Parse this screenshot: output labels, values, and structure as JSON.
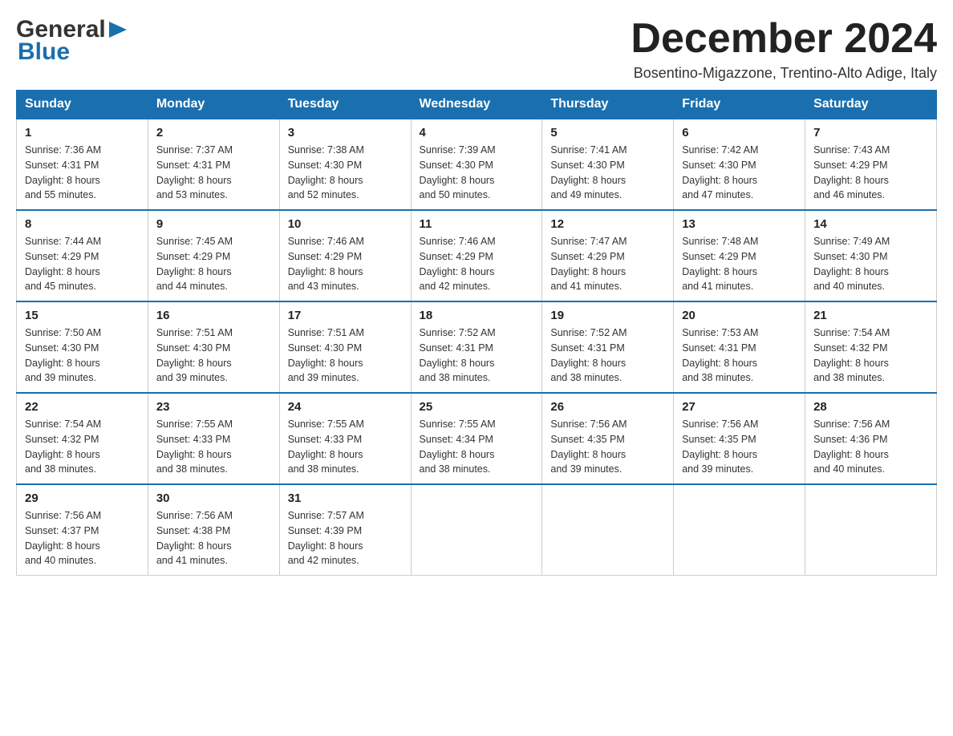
{
  "logo": {
    "general": "General",
    "blue": "Blue",
    "arrow": "▶"
  },
  "header": {
    "month": "December 2024",
    "location": "Bosentino-Migazzone, Trentino-Alto Adige, Italy"
  },
  "days_of_week": [
    "Sunday",
    "Monday",
    "Tuesday",
    "Wednesday",
    "Thursday",
    "Friday",
    "Saturday"
  ],
  "weeks": [
    [
      {
        "day": "1",
        "sunrise": "7:36 AM",
        "sunset": "4:31 PM",
        "daylight": "8 hours and 55 minutes."
      },
      {
        "day": "2",
        "sunrise": "7:37 AM",
        "sunset": "4:31 PM",
        "daylight": "8 hours and 53 minutes."
      },
      {
        "day": "3",
        "sunrise": "7:38 AM",
        "sunset": "4:30 PM",
        "daylight": "8 hours and 52 minutes."
      },
      {
        "day": "4",
        "sunrise": "7:39 AM",
        "sunset": "4:30 PM",
        "daylight": "8 hours and 50 minutes."
      },
      {
        "day": "5",
        "sunrise": "7:41 AM",
        "sunset": "4:30 PM",
        "daylight": "8 hours and 49 minutes."
      },
      {
        "day": "6",
        "sunrise": "7:42 AM",
        "sunset": "4:30 PM",
        "daylight": "8 hours and 47 minutes."
      },
      {
        "day": "7",
        "sunrise": "7:43 AM",
        "sunset": "4:29 PM",
        "daylight": "8 hours and 46 minutes."
      }
    ],
    [
      {
        "day": "8",
        "sunrise": "7:44 AM",
        "sunset": "4:29 PM",
        "daylight": "8 hours and 45 minutes."
      },
      {
        "day": "9",
        "sunrise": "7:45 AM",
        "sunset": "4:29 PM",
        "daylight": "8 hours and 44 minutes."
      },
      {
        "day": "10",
        "sunrise": "7:46 AM",
        "sunset": "4:29 PM",
        "daylight": "8 hours and 43 minutes."
      },
      {
        "day": "11",
        "sunrise": "7:46 AM",
        "sunset": "4:29 PM",
        "daylight": "8 hours and 42 minutes."
      },
      {
        "day": "12",
        "sunrise": "7:47 AM",
        "sunset": "4:29 PM",
        "daylight": "8 hours and 41 minutes."
      },
      {
        "day": "13",
        "sunrise": "7:48 AM",
        "sunset": "4:29 PM",
        "daylight": "8 hours and 41 minutes."
      },
      {
        "day": "14",
        "sunrise": "7:49 AM",
        "sunset": "4:30 PM",
        "daylight": "8 hours and 40 minutes."
      }
    ],
    [
      {
        "day": "15",
        "sunrise": "7:50 AM",
        "sunset": "4:30 PM",
        "daylight": "8 hours and 39 minutes."
      },
      {
        "day": "16",
        "sunrise": "7:51 AM",
        "sunset": "4:30 PM",
        "daylight": "8 hours and 39 minutes."
      },
      {
        "day": "17",
        "sunrise": "7:51 AM",
        "sunset": "4:30 PM",
        "daylight": "8 hours and 39 minutes."
      },
      {
        "day": "18",
        "sunrise": "7:52 AM",
        "sunset": "4:31 PM",
        "daylight": "8 hours and 38 minutes."
      },
      {
        "day": "19",
        "sunrise": "7:52 AM",
        "sunset": "4:31 PM",
        "daylight": "8 hours and 38 minutes."
      },
      {
        "day": "20",
        "sunrise": "7:53 AM",
        "sunset": "4:31 PM",
        "daylight": "8 hours and 38 minutes."
      },
      {
        "day": "21",
        "sunrise": "7:54 AM",
        "sunset": "4:32 PM",
        "daylight": "8 hours and 38 minutes."
      }
    ],
    [
      {
        "day": "22",
        "sunrise": "7:54 AM",
        "sunset": "4:32 PM",
        "daylight": "8 hours and 38 minutes."
      },
      {
        "day": "23",
        "sunrise": "7:55 AM",
        "sunset": "4:33 PM",
        "daylight": "8 hours and 38 minutes."
      },
      {
        "day": "24",
        "sunrise": "7:55 AM",
        "sunset": "4:33 PM",
        "daylight": "8 hours and 38 minutes."
      },
      {
        "day": "25",
        "sunrise": "7:55 AM",
        "sunset": "4:34 PM",
        "daylight": "8 hours and 38 minutes."
      },
      {
        "day": "26",
        "sunrise": "7:56 AM",
        "sunset": "4:35 PM",
        "daylight": "8 hours and 39 minutes."
      },
      {
        "day": "27",
        "sunrise": "7:56 AM",
        "sunset": "4:35 PM",
        "daylight": "8 hours and 39 minutes."
      },
      {
        "day": "28",
        "sunrise": "7:56 AM",
        "sunset": "4:36 PM",
        "daylight": "8 hours and 40 minutes."
      }
    ],
    [
      {
        "day": "29",
        "sunrise": "7:56 AM",
        "sunset": "4:37 PM",
        "daylight": "8 hours and 40 minutes."
      },
      {
        "day": "30",
        "sunrise": "7:56 AM",
        "sunset": "4:38 PM",
        "daylight": "8 hours and 41 minutes."
      },
      {
        "day": "31",
        "sunrise": "7:57 AM",
        "sunset": "4:39 PM",
        "daylight": "8 hours and 42 minutes."
      },
      null,
      null,
      null,
      null
    ]
  ],
  "labels": {
    "sunrise": "Sunrise:",
    "sunset": "Sunset:",
    "daylight": "Daylight:"
  }
}
